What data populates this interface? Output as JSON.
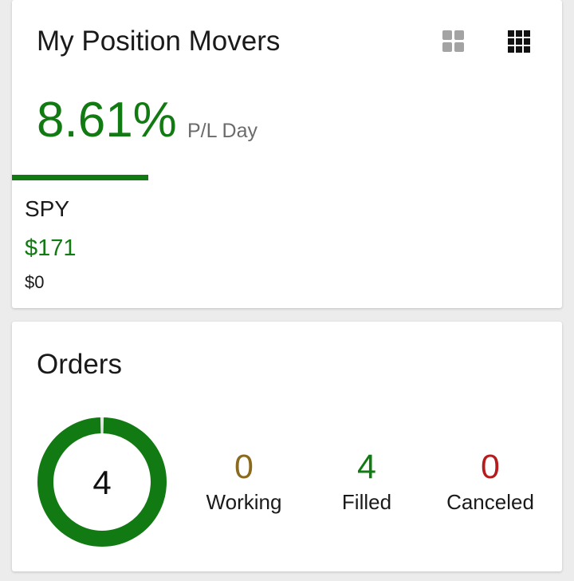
{
  "colors": {
    "positive": "#127a12",
    "working": "#8a6a1c",
    "canceled": "#b71c1c",
    "icon_gray": "#a3a3a3",
    "icon_dark": "#111111"
  },
  "movers": {
    "title": "My Position Movers",
    "pl_value": "8.61%",
    "pl_label": "P/L Day",
    "symbol": "SPY",
    "symbol_pl": "$171",
    "symbol_sub": "$0",
    "icons": [
      "grid-2x2-icon",
      "grid-3x3-icon"
    ]
  },
  "orders": {
    "title": "Orders",
    "total": "4",
    "filled_fraction": 1.0,
    "working": {
      "value": "0",
      "label": "Working"
    },
    "filled": {
      "value": "4",
      "label": "Filled"
    },
    "canceled": {
      "value": "0",
      "label": "Canceled"
    }
  }
}
